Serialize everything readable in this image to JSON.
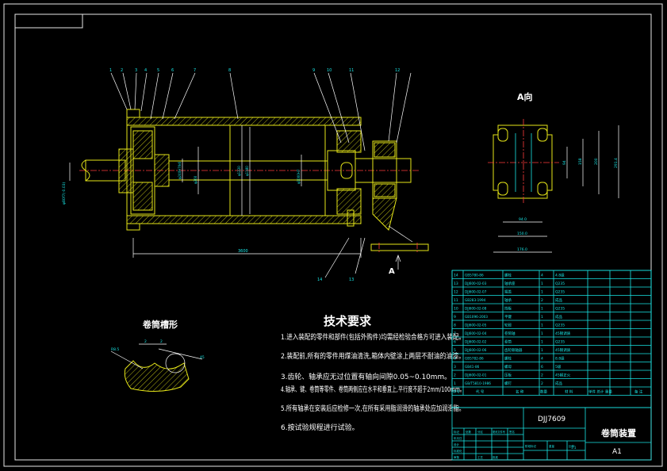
{
  "drawing": {
    "view_label": "A向",
    "section_arrow_label": "A",
    "groove_title": "卷筒槽形",
    "groove_dims": [
      "2",
      "2",
      "R8.5",
      "45"
    ],
    "left_dims": {
      "shaft_dia": "φ80f7(-0.03)",
      "length": "3600"
    },
    "inner_dims": [
      "φ240H7/k6",
      "φ260",
      "φ1220",
      "φ1180",
      "φ1000H7"
    ],
    "view_dims": {
      "w1": "94.0",
      "w2": "150.0",
      "w3": "176.0",
      "h1": "94",
      "h2": "158",
      "h3": "200",
      "h4": "291.4"
    },
    "callouts": [
      "1",
      "2",
      "3",
      "4",
      "5",
      "6",
      "7",
      "8",
      "9",
      "10",
      "11",
      "12",
      "13",
      "14"
    ]
  },
  "requirements": {
    "title": "技术要求",
    "items": [
      "1.进入装配的零件和部件(包括外购件)均需经检验合格方可进入装配。",
      "2.装配前,所有的零件用煤油清洗,箱体内壁涂上两层不耐油的油漆。",
      "3.齿轮、轴承应无过位置有轴向间隙0.05~0.10mm。",
      "4.轴承、键、卷筒等零件、卷筒两侧应在水平和垂直上,平行度不超于2mm/100mm。",
      "5.所有轴承在安装后应检修一次,在所有采用脂润滑的轴承处应加润滑脂。",
      "6.按试验规程进行试验。"
    ]
  },
  "bom": {
    "rows": [
      {
        "no": "14",
        "code": "GB5780-86",
        "name": "螺栓",
        "qty": "4",
        "mat": "4.8级"
      },
      {
        "no": "13",
        "code": "DJJ600-02-03",
        "name": "轴承座",
        "qty": "1",
        "mat": "Q235"
      },
      {
        "no": "12",
        "code": "DJJ600-02-07",
        "name": "端盖",
        "qty": "1",
        "mat": "Q235"
      },
      {
        "no": "11",
        "code": "GB283-1994",
        "name": "轴承",
        "qty": "2",
        "mat": "成品"
      },
      {
        "no": "10",
        "code": "DJJ600-02-08",
        "name": "挡板",
        "qty": "1",
        "mat": "Q235"
      },
      {
        "no": "9",
        "code": "GB1096-2003",
        "name": "平键",
        "qty": "1",
        "mat": "成品"
      },
      {
        "no": "8",
        "code": "DJJ600-02-05",
        "name": "轮毂",
        "qty": "1",
        "mat": "Q235"
      },
      {
        "no": "7",
        "code": "DJJ600-02-04",
        "name": "卷筒轴",
        "qty": "1",
        "mat": "45钢调质"
      },
      {
        "no": "6",
        "code": "DJJ600-02-02",
        "name": "卷筒",
        "qty": "1",
        "mat": "Q235"
      },
      {
        "no": "5",
        "code": "DJJ600-02-06",
        "name": "齿轮联轴器",
        "qty": "1",
        "mat": "45钢调质"
      },
      {
        "no": "4",
        "code": "GB5782-86",
        "name": "螺栓",
        "qty": "4",
        "mat": "8.8级"
      },
      {
        "no": "3",
        "code": "GB41-86",
        "name": "螺母",
        "qty": "6",
        "mat": "5级"
      },
      {
        "no": "2",
        "code": "DJJ600-02-01",
        "name": "压板",
        "qty": "2",
        "mat": "45钢正火"
      },
      {
        "no": "1",
        "code": "GB/T5810-1986",
        "name": "螺钉",
        "qty": "2",
        "mat": "成品"
      }
    ],
    "header": {
      "no": "序号",
      "code": "代 号",
      "name": "名 称",
      "qty": "数量",
      "mat": "材 料",
      "weight": "单件 总计 重量",
      "remark": "备 注"
    }
  },
  "title_block": {
    "drawing_no": "DJJ7609",
    "title": "卷筒装置",
    "sheet": "A1",
    "scale": "1:1",
    "labels": [
      "标记",
      "处数",
      "分区",
      "更改文件号",
      "签名",
      "年月日",
      "设计",
      "标准化",
      "审核",
      "工艺",
      "批准",
      "阶段标记",
      "重量",
      "比例"
    ]
  }
}
